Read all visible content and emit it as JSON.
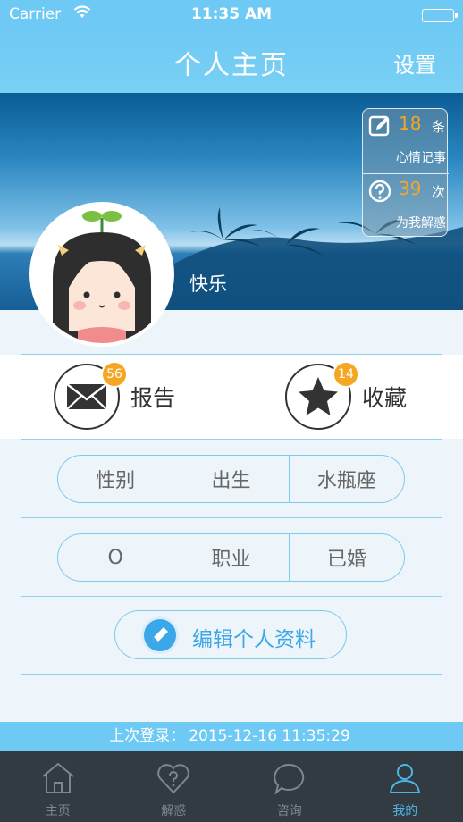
{
  "status_bar": {
    "carrier": "Carrier",
    "time": "11:35 AM"
  },
  "navbar": {
    "title": "个人主页",
    "settings_label": "设置"
  },
  "profile": {
    "username": "快乐"
  },
  "stats": [
    {
      "icon": "edit-note-icon",
      "count": "18",
      "unit": "条",
      "label": "心情记事"
    },
    {
      "icon": "question-circle-icon",
      "count": "39",
      "unit": "次",
      "label": "为我解惑"
    }
  ],
  "actions": [
    {
      "icon": "envelope-icon",
      "label": "报告",
      "badge": "56"
    },
    {
      "icon": "star-icon",
      "label": "收藏",
      "badge": "14"
    }
  ],
  "info_row_1": [
    "性别",
    "出生",
    "水瓶座"
  ],
  "info_row_2": [
    "O",
    "职业",
    "已婚"
  ],
  "edit_profile": {
    "label": "编辑个人资料"
  },
  "last_login": {
    "label": "上次登录：",
    "value": "2015-12-16 11:35:29"
  },
  "tabs": [
    {
      "icon": "home-icon",
      "label": "主页",
      "active": false
    },
    {
      "icon": "heart-question-icon",
      "label": "解惑",
      "active": false
    },
    {
      "icon": "chat-bubble-icon",
      "label": "咨询",
      "active": false
    },
    {
      "icon": "person-icon",
      "label": "我的",
      "active": true
    }
  ],
  "colors": {
    "accent": "#6ec9f4",
    "badge": "#f5a623",
    "tab_active": "#4fb4e4",
    "tabbar": "#323a42"
  }
}
